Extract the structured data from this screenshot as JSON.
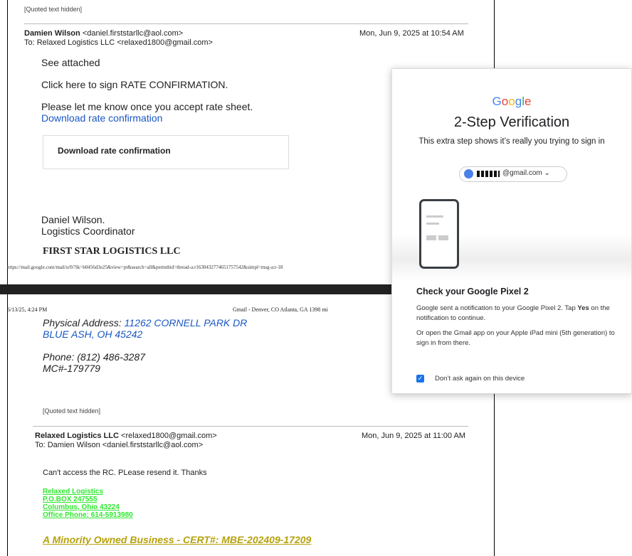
{
  "top": {
    "quoted_hidden": "[Quoted text hidden]"
  },
  "email1": {
    "from_name": "Damien Wilson",
    "from_addr": "<daniel.firststarllc@aol.com>",
    "date": "Mon, Jun 9, 2025 at 10:54 AM",
    "to": "To: Relaxed Logistics LLC <relaxed1800@gmail.com>",
    "line1": "See attached",
    "line2": "Click here to sign RATE CONFIRMATION.",
    "line3": "Please let me know once you accept rate sheet.",
    "link": "Download rate confirmation",
    "box_label": "Download rate confirmation",
    "sig_name": "Daniel Wilson.",
    "sig_title": "Logistics Coordinator",
    "company": "FIRST STAR LOGISTICS LLC"
  },
  "print": {
    "url": "https://mail.google.com/mail/u/0/?ik=b0456d3e25&view=pt&search=all&permthid=thread-a:r1630432774651757542&simpl=msg-a:r-18",
    "timestamp": "6/13/25, 4:24 PM",
    "header_center": "Gmail - Denver, CO Atlanta, GA 1398 mi"
  },
  "page2": {
    "address_label": "Physical Address: ",
    "address_line1": "11262 CORNELL PARK DR",
    "address_line2": "BLUE ASH, OH   45242",
    "phone": "Phone: (812) 486-3287",
    "mc": "MC#-179779",
    "quoted_hidden": "[Quoted text hidden]"
  },
  "email2": {
    "from_name": "Relaxed Logistics LLC",
    "from_addr": "<relaxed1800@gmail.com>",
    "date": "Mon, Jun 9, 2025 at 11:00 AM",
    "to": "To: Damien Wilson <daniel.firststarllc@aol.com>",
    "body": "Can't access the RC. PLease resend it. Thanks",
    "sig_lines": [
      "Relaxed Logistics ",
      "P.O.BOX 247555",
      "Columbus, Ohio 43224",
      "Office Phone: 614-5913980"
    ],
    "tagline": "A Minority Owned Business - CERT#: MBE-202409-17209"
  },
  "dialog": {
    "logo": "Google",
    "title": "2-Step Verification",
    "subtitle": "This extra step shows it’s really you trying to sign in",
    "email_suffix": "@gmail.com",
    "chevron": "⌄",
    "check_title": "Check your Google Pixel 2",
    "p1_a": "Google sent a notification to your Google Pixel 2. Tap ",
    "p1_b": "Yes",
    "p1_c": " on the notification to continue.",
    "p2": "Or open the Gmail app on your Apple iPad mini (5th generation) to sign in from there.",
    "checkbox_mark": "✓",
    "checkbox_label": "Don’t ask again on this device",
    "colors": {
      "blue": "#4285F4",
      "red": "#EA4335",
      "yellow": "#FBBC05",
      "green": "#34A853"
    }
  }
}
